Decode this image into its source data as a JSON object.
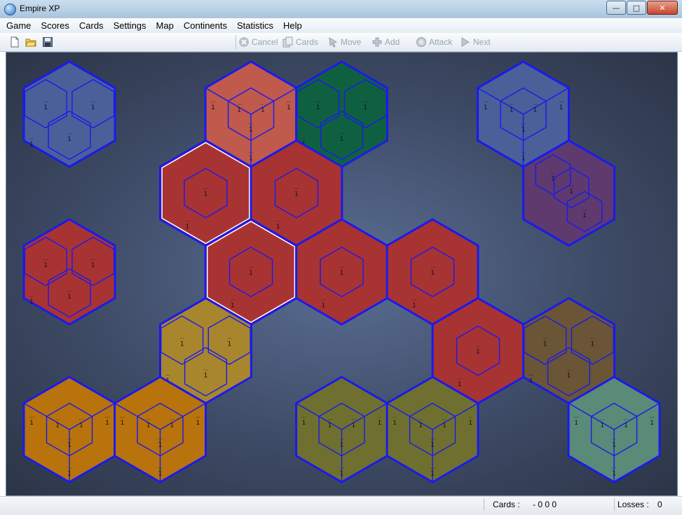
{
  "window": {
    "title": "Empire XP",
    "minimize_glyph": "—",
    "maximize_glyph": "□",
    "close_glyph": "✕"
  },
  "menu": [
    "Game",
    "Scores",
    "Cards",
    "Settings",
    "Map",
    "Continents",
    "Statistics",
    "Help"
  ],
  "toolbar": {
    "file_icons": [
      "new-file-icon",
      "open-folder-icon",
      "save-disk-icon"
    ],
    "actions": [
      {
        "label": "Cancel",
        "icon": "cancel-icon",
        "enabled": false
      },
      {
        "label": "Cards",
        "icon": "cards-icon",
        "enabled": false
      },
      {
        "label": "Move",
        "icon": "move-icon",
        "enabled": false
      },
      {
        "label": "Add",
        "icon": "add-icon",
        "enabled": false
      },
      {
        "label": "Attack",
        "icon": "attack-icon",
        "enabled": false
      },
      {
        "label": "Next",
        "icon": "next-icon",
        "enabled": false
      }
    ]
  },
  "status": {
    "cards_label": "Cards :",
    "cards_value": "- 0 0 0",
    "losses_label": "Losses :",
    "losses_value": "0"
  },
  "board": {
    "background": "#3d4a66",
    "border_color": "#1a1aee",
    "territory_marker": "...",
    "army_count": "1",
    "regions": [
      {
        "name": "blue-west",
        "color": "#4b5f99",
        "shape": "triad",
        "q": 0,
        "r": 0
      },
      {
        "name": "salmon",
        "color": "#bf5a4c",
        "shape": "cube",
        "q": 2,
        "r": 0
      },
      {
        "name": "green",
        "color": "#0f6040",
        "shape": "triad",
        "q": 3,
        "r": 0
      },
      {
        "name": "blue-east",
        "color": "#4b5f99",
        "shape": "cube",
        "q": 5,
        "r": 0
      },
      {
        "name": "purple",
        "color": "#5e3a6e",
        "shape": "stack",
        "q": 5,
        "r": 1
      },
      {
        "name": "red-center",
        "color": "#a83333",
        "shape": "single",
        "q": 1,
        "r": 1,
        "selected": true
      },
      {
        "name": "red-center-2",
        "color": "#a83333",
        "shape": "single",
        "q": 2,
        "r": 1
      },
      {
        "name": "red-center-3",
        "color": "#a83333",
        "shape": "single",
        "q": 2,
        "r": 2,
        "selected": true
      },
      {
        "name": "red-mid",
        "color": "#a83333",
        "shape": "single",
        "q": 3,
        "r": 2
      },
      {
        "name": "red-mid-2",
        "color": "#a83333",
        "shape": "single",
        "q": 4,
        "r": 2
      },
      {
        "name": "red-mid-3",
        "color": "#a83333",
        "shape": "single",
        "q": 4,
        "r": 3
      },
      {
        "name": "red-west",
        "color": "#a83333",
        "shape": "triad",
        "q": 0,
        "r": 2
      },
      {
        "name": "gold",
        "color": "#a7862e",
        "shape": "triad",
        "q": 1,
        "r": 3
      },
      {
        "name": "brown",
        "color": "#6a5536",
        "shape": "triad",
        "q": 5,
        "r": 3
      },
      {
        "name": "orange-1",
        "color": "#b8730c",
        "shape": "cube",
        "q": 0,
        "r": 4
      },
      {
        "name": "orange-2",
        "color": "#b8730c",
        "shape": "cube",
        "q": 1,
        "r": 4
      },
      {
        "name": "olive-1",
        "color": "#6f702f",
        "shape": "cube",
        "q": 3,
        "r": 4
      },
      {
        "name": "olive-2",
        "color": "#6f702f",
        "shape": "cube",
        "q": 4,
        "r": 4
      },
      {
        "name": "teal",
        "color": "#5a8a78",
        "shape": "cube",
        "q": 6,
        "r": 4
      }
    ]
  }
}
